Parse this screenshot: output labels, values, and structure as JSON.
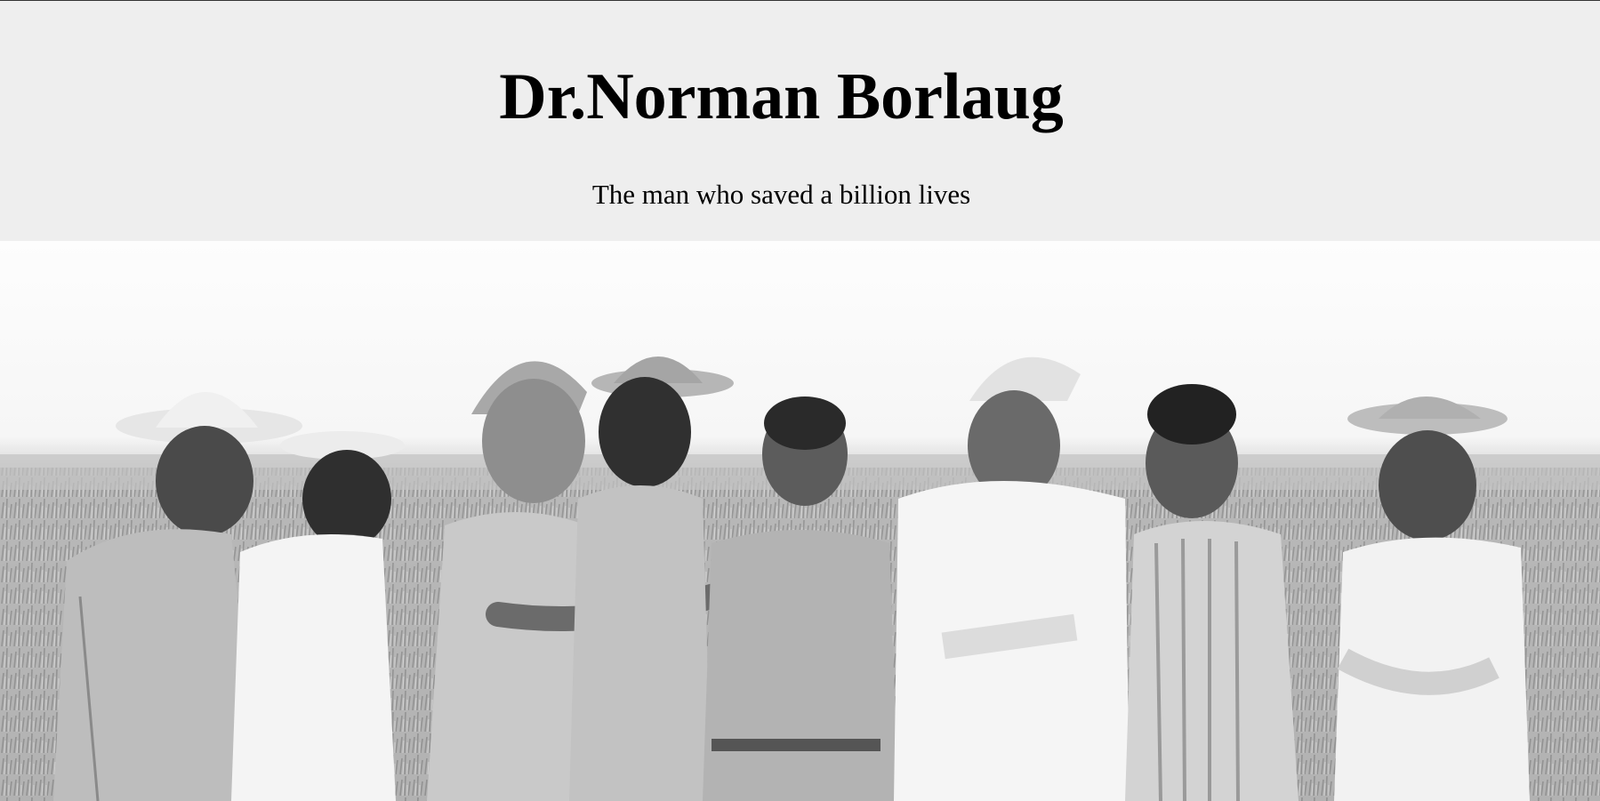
{
  "header": {
    "title": "Dr.Norman Borlaug",
    "subtitle": "The man who saved a billion lives"
  },
  "image": {
    "subject": "group-photo",
    "style": "black-and-white",
    "people_count": 8
  },
  "colors": {
    "header_bg": "#eeeeee",
    "text": "#000000",
    "page_bg": "#ffffff"
  }
}
